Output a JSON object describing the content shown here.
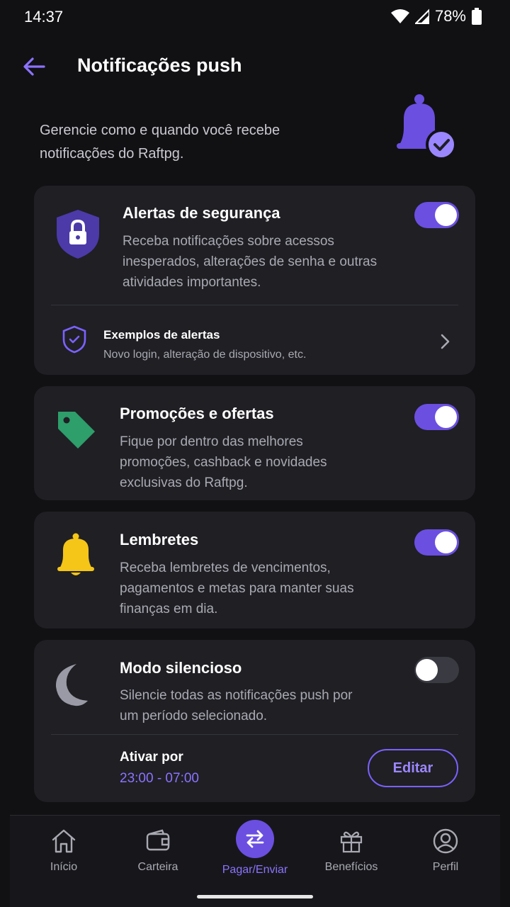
{
  "status_bar": {
    "time": "14:37",
    "battery": "78%"
  },
  "header": {
    "title": "Notificações push"
  },
  "intro": {
    "text": "Gerencie como e quando você recebe notificações do Raftpg."
  },
  "security": {
    "title": "Alertas de segurança",
    "description": "Receba notificações sobre acessos inesperados, alterações de senha e outras atividades importantes.",
    "enabled": true,
    "examples_title": "Exemplos de alertas",
    "examples_desc": "Novo login, alteração de dispositivo, etc."
  },
  "promotions": {
    "title": "Promoções e ofertas",
    "description": "Fique por dentro das melhores promoções, cashback e novidades exclusivas do Raftpg.",
    "enabled": true
  },
  "reminders": {
    "title": "Lembretes",
    "description": "Receba lembretes de vencimentos, pagamentos e metas para manter suas finanças em dia.",
    "enabled": true
  },
  "silent": {
    "title": "Modo silencioso",
    "description": "Silencie todas as notificações push por um período selecionado.",
    "enabled": false,
    "active_label": "Ativar por",
    "time_range": "23:00 - 07:00",
    "edit_label": "Editar"
  },
  "nav": {
    "items": [
      {
        "label": "Início",
        "icon": "home-icon"
      },
      {
        "label": "Carteira",
        "icon": "wallet-icon"
      },
      {
        "label": "Pagar/Enviar",
        "icon": "transfer-icon"
      },
      {
        "label": "Benefícios",
        "icon": "gift-icon"
      },
      {
        "label": "Perfil",
        "icon": "profile-icon"
      }
    ]
  },
  "colors": {
    "accent": "#6b4fe0",
    "background": "#111114",
    "card": "#1f1f24",
    "promo": "#2e9e6b",
    "reminder": "#f5c518"
  }
}
